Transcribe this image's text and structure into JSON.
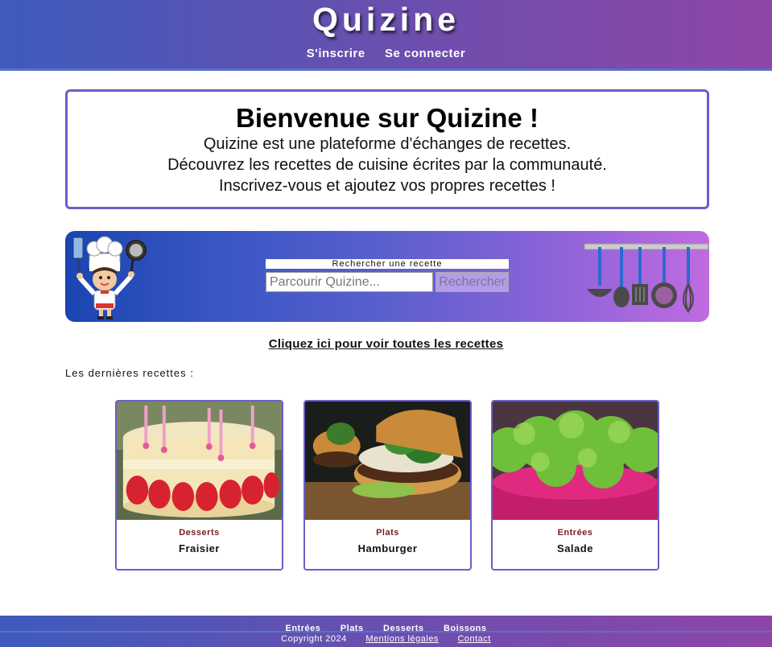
{
  "header": {
    "title": "Quizine",
    "nav": [
      "S'inscrire",
      "Se connecter"
    ]
  },
  "welcome": {
    "heading": "Bienvenue sur Quizine !",
    "lines": [
      "Quizine est une plateforme d'échanges de recettes.",
      "Découvrez les recettes de cuisine écrites par la communauté.",
      "Inscrivez-vous et ajoutez vos propres recettes !"
    ]
  },
  "search": {
    "label": "Rechercher une recette",
    "placeholder": "Parcourir Quizine...",
    "button": "Rechercher"
  },
  "all_recipes_link": "Cliquez ici pour voir toutes les recettes",
  "latest_heading": "Les dernières recettes :",
  "cards": [
    {
      "category": "Desserts",
      "name": "Fraisier",
      "icon": "cake-photo"
    },
    {
      "category": "Plats",
      "name": "Hamburger",
      "icon": "burger-photo"
    },
    {
      "category": "Entrées",
      "name": "Salade",
      "icon": "salad-photo"
    }
  ],
  "footer": {
    "nav": [
      "Entrées",
      "Plats",
      "Desserts",
      "Boissons"
    ],
    "copyright": "Copyright 2024",
    "legal": "Mentions légales",
    "contact": "Contact"
  },
  "colors": {
    "accent_border": "#6a5fc8",
    "header_start": "#3d5bbd",
    "header_end": "#8e45a8",
    "category_text": "#7a1d1d"
  }
}
